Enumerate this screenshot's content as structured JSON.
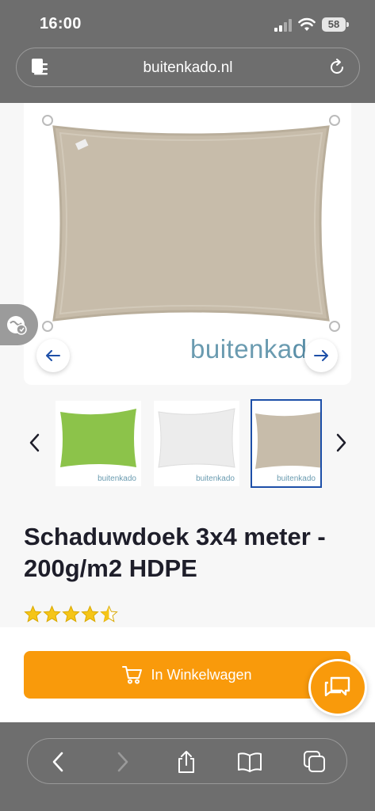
{
  "status_bar": {
    "time": "16:00",
    "battery": "58"
  },
  "browser": {
    "url": "buitenkado.nl"
  },
  "gallery": {
    "brand_logo_text": "buitenkado",
    "main_image": "beige-shade-sail",
    "thumbnails": [
      {
        "color": "#8cc34a",
        "logo": "buitenkado",
        "active": false
      },
      {
        "color": "#ececec",
        "logo": "buitenkado",
        "active": false
      },
      {
        "color": "#c7bcaa",
        "logo": "buitenkado",
        "active": true
      }
    ]
  },
  "product": {
    "title": "Schaduwdoek 3x4 meter - 200g/m2 HDPE",
    "rating": 4.5,
    "rating_max": 5
  },
  "cart": {
    "button_label": "In Winkelwagen"
  },
  "colors": {
    "accent": "#f99a0b",
    "sail_beige": "#c7bcaa",
    "active_thumb_border": "#1d4fa8",
    "star": "#f5c518"
  }
}
